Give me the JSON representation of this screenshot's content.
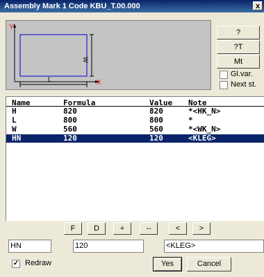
{
  "window": {
    "title": "Assembly Mark 1 Code KBU_T.00.000",
    "close_glyph": "x"
  },
  "preview": {
    "y_label": "Y",
    "x_label": "X",
    "w_label": "W",
    "l_label": "L",
    "frame_color": "#0000cc",
    "axis_color": "#ff0000"
  },
  "side_buttons": {
    "help": "?",
    "help_t": "?T",
    "mt": "Mt"
  },
  "checks": {
    "gl_var": "Gl.var.",
    "next_st": "Next st."
  },
  "table": {
    "headers": {
      "name": "Name",
      "formula": "Formula",
      "value": "Value",
      "note": "Note"
    },
    "rows": [
      {
        "name": "H",
        "formula": "820",
        "value": "820",
        "note": "*<HK_N>"
      },
      {
        "name": "L",
        "formula": "800",
        "value": "800",
        "note": "*"
      },
      {
        "name": "W",
        "formula": "560",
        "value": "560",
        "note": "*<WK_N>"
      },
      {
        "name": "HN",
        "formula": "120",
        "value": "120",
        "note": "<KLEG>"
      }
    ]
  },
  "toolbar": {
    "f": "F",
    "d": "D",
    "plus": "+",
    "minus": "--",
    "prev": "<",
    "next": ">"
  },
  "edit": {
    "name": "HN",
    "formula": "120",
    "note": "<KLEG>"
  },
  "redraw": {
    "label": "Redraw",
    "checked_glyph": "✓"
  },
  "actions": {
    "yes": "Yes",
    "cancel": "Cancel"
  }
}
